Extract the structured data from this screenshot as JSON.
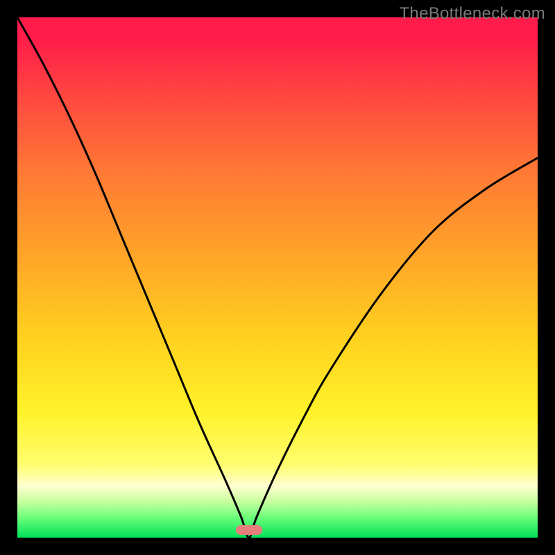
{
  "branding": {
    "watermark": "TheBottleneck.com"
  },
  "colors": {
    "page_bg": "#000000",
    "gradient_top": "#ff1c4a",
    "gradient_bottom": "#00e05a",
    "curve": "#000000",
    "marker": "#e77e7e",
    "watermark_text": "#7a7a7a"
  },
  "chart_data": {
    "type": "line",
    "title": "",
    "xlabel": "",
    "ylabel": "",
    "xlim": [
      0,
      100
    ],
    "ylim": [
      0,
      100
    ],
    "annotations": [
      {
        "kind": "marker-pill",
        "x": 44.5,
        "y": 1.5
      }
    ],
    "series": [
      {
        "name": "bottleneck-curve",
        "x": [
          0,
          5,
          10,
          15,
          20,
          25,
          30,
          35,
          40,
          43,
          44.5,
          46,
          50,
          55,
          60,
          70,
          80,
          90,
          100
        ],
        "y": [
          100,
          91,
          81,
          70,
          58,
          46,
          34,
          22,
          11,
          4,
          0,
          4,
          13,
          23,
          32,
          47,
          59,
          67,
          73
        ]
      }
    ]
  }
}
